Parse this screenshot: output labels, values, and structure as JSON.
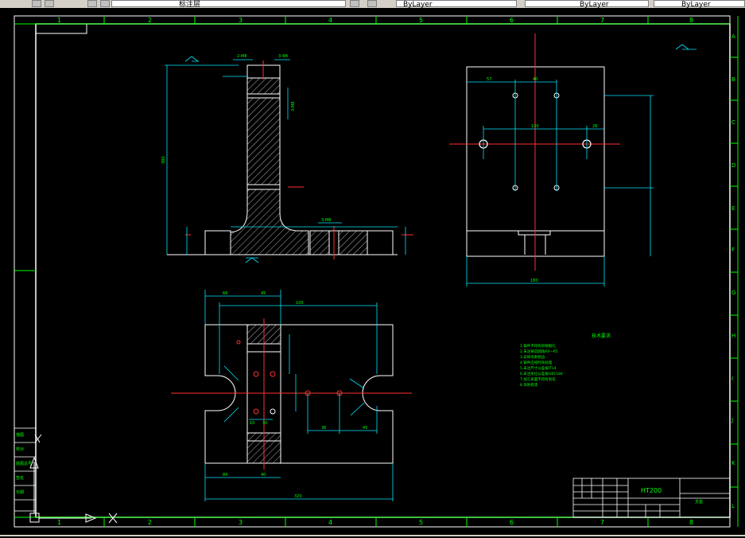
{
  "toolbar": {
    "layer_name": "标注层",
    "color_control": "ByLayer",
    "linetype_control": "ByLayer",
    "lineweight_control": "ByLayer"
  },
  "drawing": {
    "column_numbers": [
      "1",
      "2",
      "3",
      "4",
      "5",
      "6",
      "7",
      "8"
    ],
    "row_letters": [
      "A",
      "B",
      "C",
      "D",
      "E",
      "F",
      "G",
      "H",
      "I",
      "J",
      "K",
      "L"
    ],
    "material": "HT200",
    "tech_title": "技术要求",
    "tech_notes": [
      "1.铸件不得有砂眼缩孔",
      "2.未注铸造圆角R3～R5",
      "3.去除毛刺锐边",
      "4.铸件应经时效处理",
      "5.未注尺寸公差按IT14",
      "6.未注形位公差按GB1184",
      "7.加工表面不得有划伤",
      "8.涂防锈漆"
    ],
    "dims": {
      "front_height": "380",
      "front_top_left": "2-M8",
      "front_top_right": "3-Φ8",
      "front_side": "3-M8",
      "front_base": "3-M8",
      "top_57": "57",
      "top_40": "40",
      "top_130": "130",
      "top_28": "28",
      "top_180": "180",
      "bottom_68": "68",
      "bottom_45": "45",
      "bottom_100": "100",
      "bottom_36": "36",
      "bottom_45b": "45",
      "bottom_320": "320",
      "bottom_84": "84",
      "bottom_40": "40",
      "bottom_10": "10",
      "bottom_30": "30"
    },
    "title_block_name": "支座",
    "left_labels": [
      "描图",
      "校对",
      "底图总号",
      "签名",
      "日期"
    ]
  }
}
